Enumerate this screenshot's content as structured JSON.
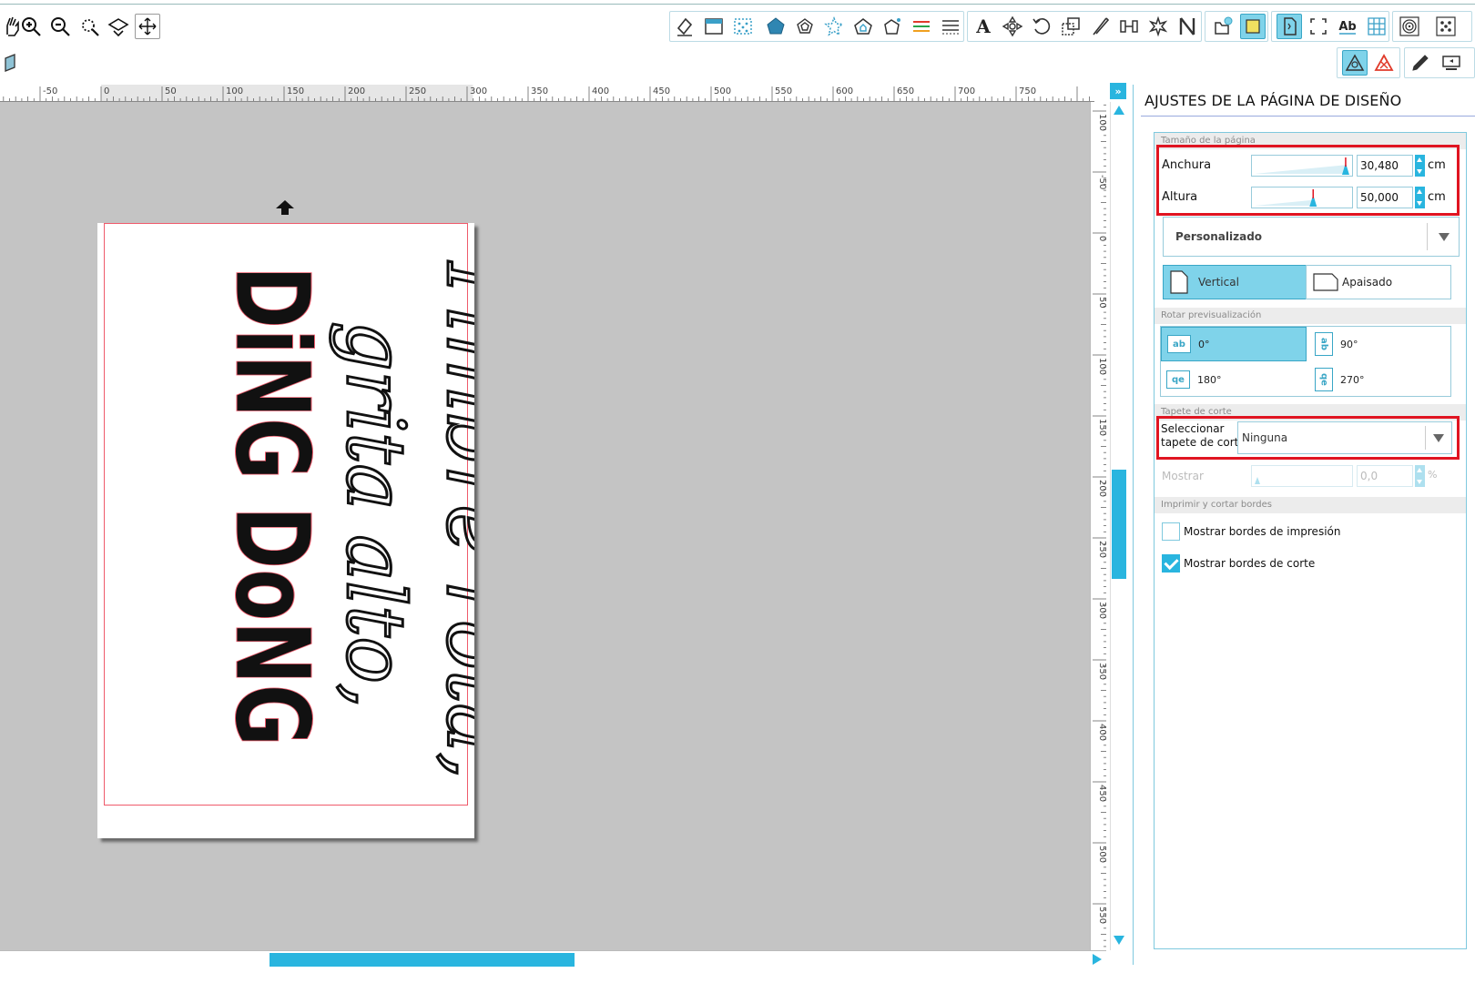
{
  "toolbar": {
    "tools_left": [
      "pan-icon",
      "zoom-in-icon",
      "zoom-out-icon",
      "zoom-selection-icon",
      "fit-page-icon",
      "fit-all-icon"
    ],
    "tools_right": [
      "eraser-icon",
      "fill-panel-icon",
      "pattern-panel-icon",
      "shape-pentagon-icon",
      "shape-outline-icon",
      "star-icon",
      "house-icon",
      "polygon-icon",
      "line-color-icon",
      "line-style-icon",
      "text-icon",
      "transform-icon",
      "rotate-icon",
      "scale-icon",
      "knife-icon",
      "align-icon",
      "offset-icon",
      "trace-icon",
      "library-icon",
      "store-icon",
      "page-setup-icon",
      "registration-icon",
      "text-style-icon",
      "grid-icon",
      "spiral-icon",
      "dots-icon"
    ]
  },
  "ruler": {
    "h_labels": [
      "-50",
      "0",
      "50",
      "100",
      "150",
      "200",
      "250",
      "300",
      "350",
      "400",
      "450",
      "500",
      "550",
      "600",
      "650",
      "700",
      "750"
    ],
    "v_labels": [
      "100",
      "-50",
      "0",
      "50",
      "100",
      "150",
      "200",
      "250",
      "300",
      "350",
      "400",
      "450",
      "500",
      "550"
    ]
  },
  "canvas": {
    "script_line1": "Timbre rota,",
    "script_line2": "grita alto,",
    "bold_line": "DiNG DoNG"
  },
  "panel": {
    "title": "AJUSTES DE LA PÁGINA DE DISEÑO",
    "page_size_header": "Tamaño de la página",
    "width_label": "Anchura",
    "width_value": "30,480",
    "width_unit": "cm",
    "width_slider": 0.97,
    "height_label": "Altura",
    "height_value": "50,000",
    "height_unit": "cm",
    "height_slider": 0.62,
    "size_preset": "Personalizado",
    "orientation_vertical": "Vertical",
    "orientation_landscape": "Apaisado",
    "rotate_header": "Rotar previsualización",
    "rot_0": "0°",
    "rot_90": "90°",
    "rot_180": "180°",
    "rot_270": "270°",
    "rot_0_icon": "ab",
    "rot_90_icon": "ab",
    "rot_180_icon": "qe",
    "rot_270_icon": "qe",
    "mat_header": "Tapete de corte",
    "mat_label_1": "Seleccionar",
    "mat_label_2": "tapete de corte",
    "mat_value": "Ninguna",
    "show_label": "Mostrar",
    "show_value": "0,0",
    "show_unit": "%",
    "borders_header": "Imprimir y cortar bordes",
    "print_borders_label": "Mostrar bordes de impresión",
    "cut_borders_label": "Mostrar bordes de corte",
    "print_borders_checked": false,
    "cut_borders_checked": true
  },
  "colors": {
    "accent": "#29b5df",
    "highlight_red": "#e01421",
    "cut_border": "#ef5a6b",
    "canvas_bg": "#c4c4c4"
  }
}
